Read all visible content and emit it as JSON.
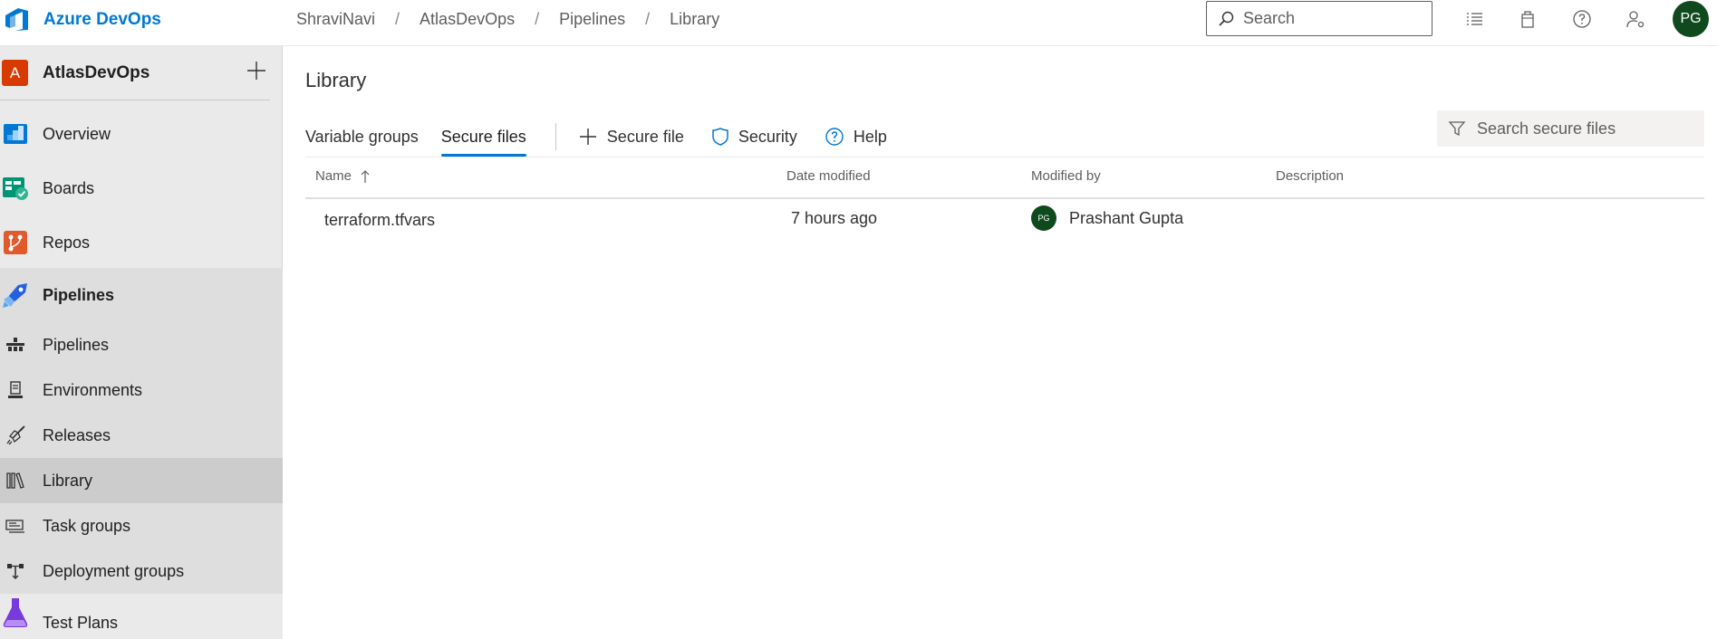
{
  "app": {
    "name": "Azure DevOps"
  },
  "breadcrumb": [
    "ShraviNavi",
    "AtlasDevOps",
    "Pipelines",
    "Library"
  ],
  "search": {
    "placeholder": "Search"
  },
  "user": {
    "initials": "PG"
  },
  "org": {
    "badge": "A",
    "name": "AtlasDevOps"
  },
  "sidebar": {
    "items": [
      {
        "label": "Overview",
        "icon": "overview-icon"
      },
      {
        "label": "Boards",
        "icon": "boards-icon"
      },
      {
        "label": "Repos",
        "icon": "repos-icon"
      },
      {
        "label": "Pipelines",
        "icon": "pipelines-icon"
      },
      {
        "label": "Pipelines",
        "icon": "pipelines-sub-icon"
      },
      {
        "label": "Environments",
        "icon": "environments-icon"
      },
      {
        "label": "Releases",
        "icon": "releases-icon"
      },
      {
        "label": "Library",
        "icon": "library-icon"
      },
      {
        "label": "Task groups",
        "icon": "task-groups-icon"
      },
      {
        "label": "Deployment groups",
        "icon": "deployment-groups-icon"
      },
      {
        "label": "Test Plans",
        "icon": "test-plans-icon"
      }
    ]
  },
  "main": {
    "title": "Library",
    "tabs": [
      {
        "label": "Variable groups",
        "selected": false
      },
      {
        "label": "Secure files",
        "selected": true
      }
    ],
    "commands": {
      "add_label": "Secure file",
      "security_label": "Security",
      "help_label": "Help"
    },
    "filter": {
      "placeholder": "Search secure files"
    },
    "table": {
      "columns": [
        "Name",
        "Date modified",
        "Modified by",
        "Description"
      ],
      "sort_column": "Name",
      "sort_direction": "ascending",
      "rows": [
        {
          "name": "terraform.tfvars",
          "date_modified": "7 hours ago",
          "modified_by": "Prashant Gupta",
          "modified_by_initials": "PG",
          "description": ""
        }
      ]
    }
  },
  "colors": {
    "accent": "#0078d4",
    "avatar": "#0e4a1e",
    "org_badge": "#d83b01"
  }
}
